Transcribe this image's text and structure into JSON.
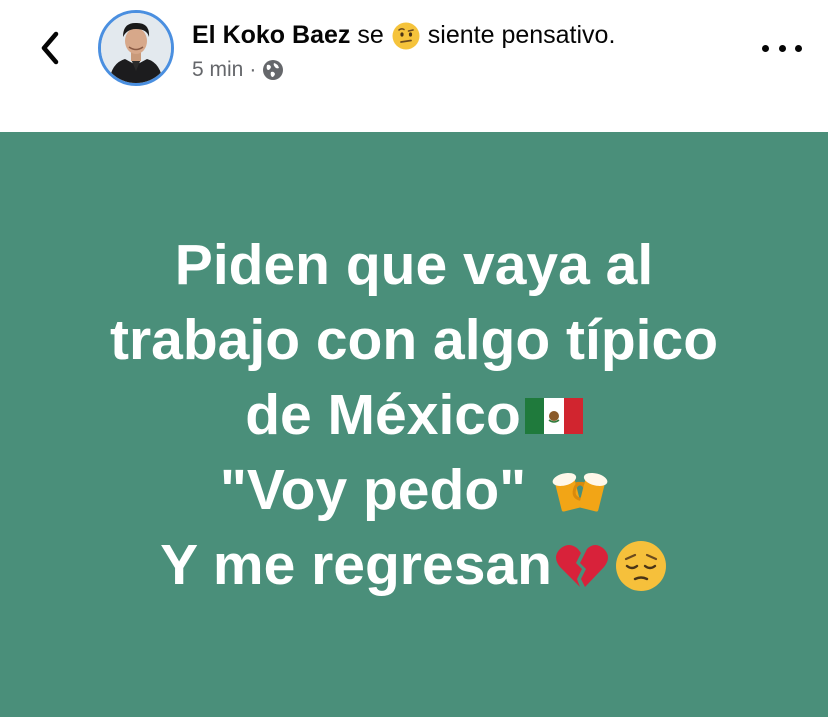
{
  "header": {
    "author": "El Koko Baez",
    "verb": "se",
    "feeling": "siente pensativo.",
    "time": "5 min",
    "separator": "·",
    "icons": {
      "back": "chevron-left-icon",
      "feeling": "thinking-face-emoji",
      "audience": "globe-icon",
      "more": "more-dots-icon"
    }
  },
  "post": {
    "background_color": "#4a8f7a",
    "lines": [
      "Piden que vaya al",
      "trabajo con algo típico",
      "de México",
      "\"Voy pedo\"",
      "Y me regresan"
    ],
    "emojis": [
      "mexico-flag-emoji",
      "beer-mugs-emoji",
      "broken-heart-emoji",
      "pensive-face-emoji"
    ]
  }
}
